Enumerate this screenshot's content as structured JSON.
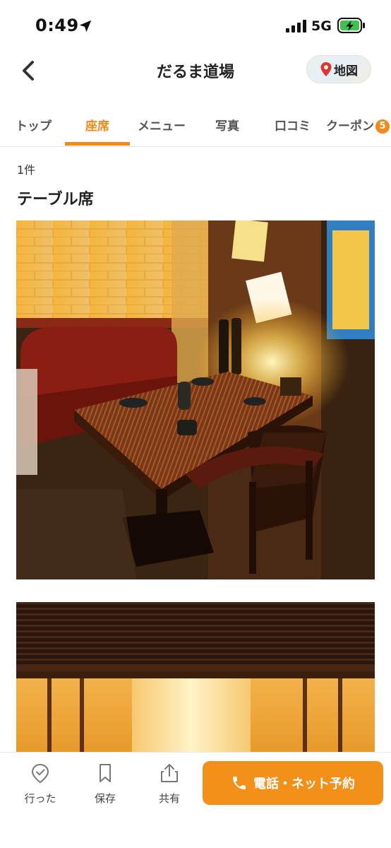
{
  "status_bar": {
    "time": "0:49",
    "network": "5G"
  },
  "header": {
    "title": "だるま道場",
    "map_label": "地図"
  },
  "tabs": [
    {
      "label": "トップ"
    },
    {
      "label": "座席"
    },
    {
      "label": "メニュー"
    },
    {
      "label": "写真"
    },
    {
      "label": "口コミ"
    },
    {
      "label": "クーポン",
      "badge": "5"
    }
  ],
  "active_tab": "座席",
  "result_count": "1件",
  "section": {
    "title": "テーブル席"
  },
  "bottom_bar": {
    "went_label": "行った",
    "save_label": "保存",
    "share_label": "共有",
    "reserve_label": "電話・ネット予約"
  },
  "colors": {
    "accent": "#f18a1a",
    "reserve_button": "#f39019"
  },
  "icons": [
    "location-arrow-icon",
    "signal-icon",
    "battery-charging-icon",
    "back-chevron-icon",
    "map-pin-icon",
    "check-badge-icon",
    "bookmark-icon",
    "share-icon",
    "phone-icon"
  ]
}
